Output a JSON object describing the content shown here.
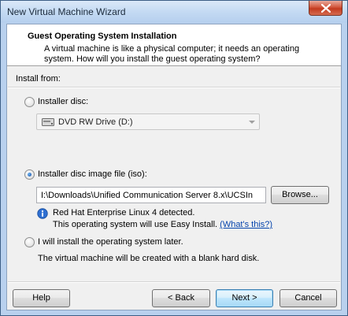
{
  "window": {
    "title": "New Virtual Machine Wizard"
  },
  "header": {
    "title": "Guest Operating System Installation",
    "description": "A virtual machine is like a physical computer; it needs an operating system. How will you install the guest operating system?"
  },
  "install_from": {
    "label": "Install from:",
    "options": [
      {
        "label": "Installer disc:",
        "selected": false
      },
      {
        "label": "Installer disc image file (iso):",
        "selected": true
      },
      {
        "label": "I will install the operating system later.",
        "selected": false
      }
    ],
    "disc_drive": {
      "selected_value": "DVD RW Drive (D:)",
      "icon": "dvd-drive-icon"
    },
    "iso_path": "I:\\Downloads\\Unified Communication Server 8.x\\UCSIn",
    "browse_label": "Browse...",
    "detected_text": "Red Hat Enterprise Linux 4 detected.",
    "easy_install_text": "This operating system will use Easy Install.",
    "whats_this_link": "(What's this?)",
    "later_note": "The virtual machine will be created with a blank hard disk."
  },
  "footer": {
    "help_label": "Help",
    "back_label": "< Back",
    "next_label": "Next >",
    "cancel_label": "Cancel"
  },
  "colors": {
    "frame": "#b9d1ee",
    "close_button": "#c33a1f",
    "default_button_border": "#3c7fb1",
    "link": "#0645ad"
  }
}
